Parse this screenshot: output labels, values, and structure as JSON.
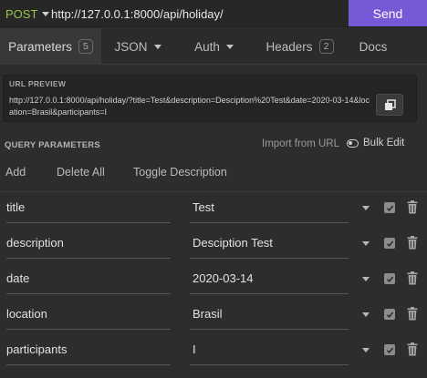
{
  "request": {
    "method": "POST",
    "url": "http://127.0.0.1:8000/api/holiday/",
    "send_label": "Send"
  },
  "tabs": [
    {
      "label": "Parameters",
      "badge": "5",
      "active": true
    },
    {
      "label": "JSON",
      "dropdown": true
    },
    {
      "label": "Auth",
      "dropdown": true
    },
    {
      "label": "Headers",
      "badge": "2"
    },
    {
      "label": "Docs"
    }
  ],
  "preview": {
    "title": "URL PREVIEW",
    "url": "http://127.0.0.1:8000/api/holiday/?title=Test&description=Desciption%20Test&date=2020-03-14&location=Brasil&participants=I",
    "copy_icon": "copy-icon"
  },
  "query": {
    "title": "QUERY PARAMETERS",
    "import_label": "Import from URL",
    "bulk_edit_label": "Bulk Edit",
    "add_label": "Add",
    "delete_all_label": "Delete All",
    "toggle_desc_label": "Toggle Description",
    "params": [
      {
        "name": "title",
        "value": "Test",
        "enabled": true
      },
      {
        "name": "description",
        "value": "Desciption Test",
        "enabled": true
      },
      {
        "name": "date",
        "value": "2020-03-14",
        "enabled": true
      },
      {
        "name": "location",
        "value": "Brasil",
        "enabled": true
      },
      {
        "name": "participants",
        "value": "I",
        "enabled": true
      }
    ]
  },
  "colors": {
    "method": "#97c549",
    "send": "#7559d6",
    "background": "#2d2d2d"
  }
}
